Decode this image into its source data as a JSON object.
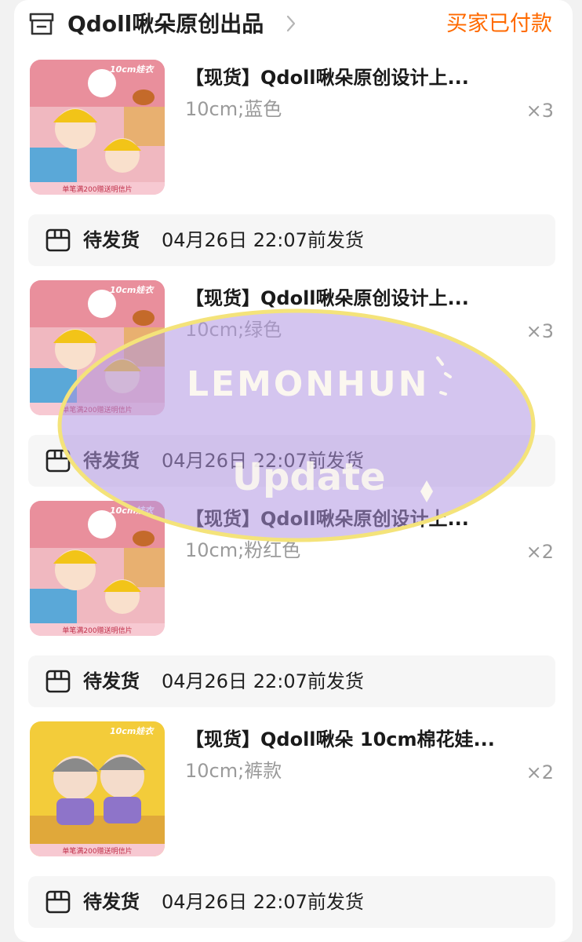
{
  "order": {
    "store_name": "Qdoll啾朵原创出品",
    "status": "买家已付款",
    "colors": {
      "accent": "#ff6a00",
      "text": "#1f1f1f",
      "muted": "#9a9a9a",
      "panel": "#f6f6f6"
    }
  },
  "items": [
    {
      "title": "【现货】Qdoll啾朵原创设计上...",
      "spec": "10cm;蓝色",
      "qty": "×3",
      "thumb_badge": "10cm娃衣",
      "thumb_footer": "单笔满200赠送明信片",
      "ship_status": "待发货",
      "ship_date": "04月26日 22:07前发货"
    },
    {
      "title": "【现货】Qdoll啾朵原创设计上...",
      "spec": "10cm;绿色",
      "qty": "×3",
      "thumb_badge": "10cm娃衣",
      "thumb_footer": "单笔满200赠送明信片",
      "ship_status": "待发货",
      "ship_date": "04月26日 22:07前发货"
    },
    {
      "title": "【现货】Qdoll啾朵原创设计上...",
      "spec": "10cm;粉红色",
      "qty": "×2",
      "thumb_badge": "10cm娃衣",
      "thumb_footer": "单笔满200赠送明信片",
      "ship_status": "待发货",
      "ship_date": "04月26日 22:07前发货"
    },
    {
      "title": "【现货】Qdoll啾朵 10cm棉花娃...",
      "spec": "10cm;裤款",
      "qty": "×2",
      "thumb_badge": "10cm娃衣",
      "thumb_footer": "单笔满200赠送明信片",
      "ship_status": "待发货",
      "ship_date": "04月26日 22:07前发货"
    }
  ],
  "watermark": {
    "line1": "LEMONHUN",
    "line2": "Update"
  },
  "icons": {
    "store": "store-icon",
    "chevron": "chevron-right-icon",
    "shipping": "package-box-icon"
  }
}
